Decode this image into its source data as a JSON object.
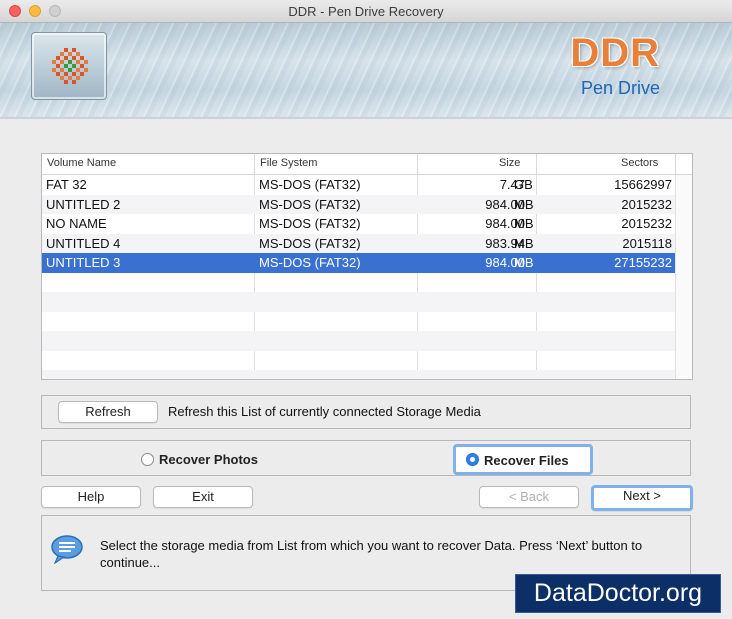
{
  "window": {
    "title": "DDR - Pen Drive Recovery"
  },
  "header": {
    "brand": "DDR",
    "subtitle": "Pen Drive"
  },
  "table": {
    "columns": [
      "Volume Name",
      "File System",
      "Size",
      "Sectors"
    ],
    "rows": [
      {
        "name": "FAT 32",
        "fs": "MS-DOS (FAT32)",
        "size": "7.47",
        "unit": "GB",
        "sectors": "15662997"
      },
      {
        "name": "UNTITLED 2",
        "fs": "MS-DOS (FAT32)",
        "size": "984.00",
        "unit": "MB",
        "sectors": "2015232"
      },
      {
        "name": "NO NAME",
        "fs": "MS-DOS (FAT32)",
        "size": "984.00",
        "unit": "MB",
        "sectors": "2015232"
      },
      {
        "name": "UNTITLED 4",
        "fs": "MS-DOS (FAT32)",
        "size": "983.94",
        "unit": "MB",
        "sectors": "2015118"
      },
      {
        "name": "UNTITLED 3",
        "fs": "MS-DOS (FAT32)",
        "size": "984.00",
        "unit": "MB",
        "sectors": "27155232"
      }
    ],
    "selected_row": "UNTITLED 3"
  },
  "refresh": {
    "button": "Refresh",
    "text": "Refresh this List of currently connected Storage Media"
  },
  "options": {
    "photos": "Recover Photos",
    "files": "Recover Files",
    "selected": "Recover Files"
  },
  "buttons": {
    "help": "Help",
    "exit": "Exit",
    "back": "< Back",
    "next": "Next >"
  },
  "info": {
    "message": "Select the storage media from List from which you want to recover Data. Press ‘Next’ button to continue..."
  },
  "watermark": "DataDoctor.org",
  "colors": {
    "selection": "#3a71d0",
    "brand": "#e8803a",
    "subtitle": "#1f66b3",
    "watermark_bg": "#0b2f66"
  }
}
